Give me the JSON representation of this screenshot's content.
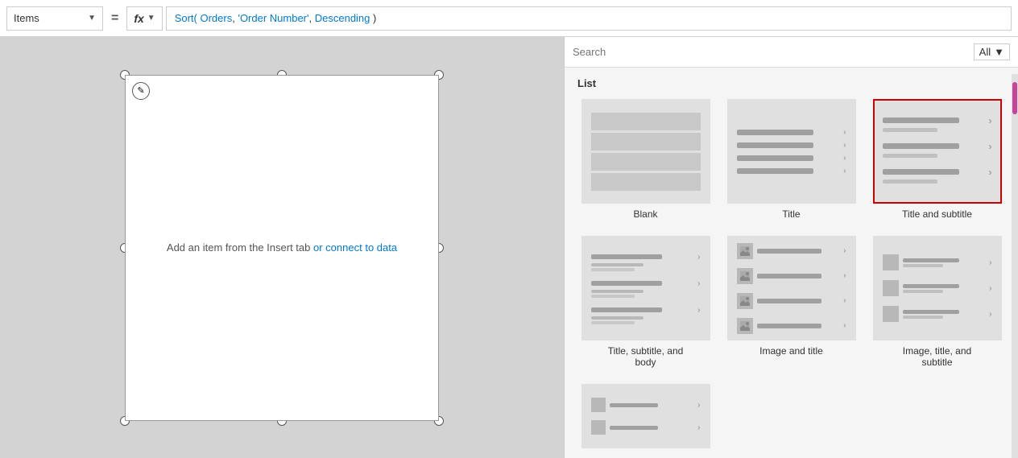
{
  "toolbar": {
    "items_label": "Items",
    "equals": "=",
    "fx_label": "fx",
    "formula": "Sort( Orders, 'Order Number', Descending )",
    "formula_parts": {
      "func": "Sort(",
      "table": " Orders",
      "comma1": ",",
      "field": " 'Order Number'",
      "comma2": ",",
      "order": " Descending",
      "close": " )"
    }
  },
  "search": {
    "placeholder": "Search",
    "filter_label": "All"
  },
  "panel": {
    "section_label": "List",
    "templates": [
      {
        "id": "blank",
        "label": "Blank",
        "type": "blank",
        "selected": false
      },
      {
        "id": "title",
        "label": "Title",
        "type": "title",
        "selected": false
      },
      {
        "id": "title-subtitle",
        "label": "Title and subtitle",
        "type": "title-subtitle",
        "selected": true
      },
      {
        "id": "title-subtitle-body",
        "label": "Title, subtitle, and body",
        "type": "title-subtitle-body",
        "selected": false
      },
      {
        "id": "image-title",
        "label": "Image and title",
        "type": "image-title",
        "selected": false
      },
      {
        "id": "image-title-subtitle",
        "label": "Image, title, and subtitle",
        "type": "image-title-subtitle",
        "selected": false
      }
    ]
  },
  "canvas": {
    "placeholder_text": "Add an item from the Insert tab",
    "placeholder_link": "or connect to data"
  }
}
